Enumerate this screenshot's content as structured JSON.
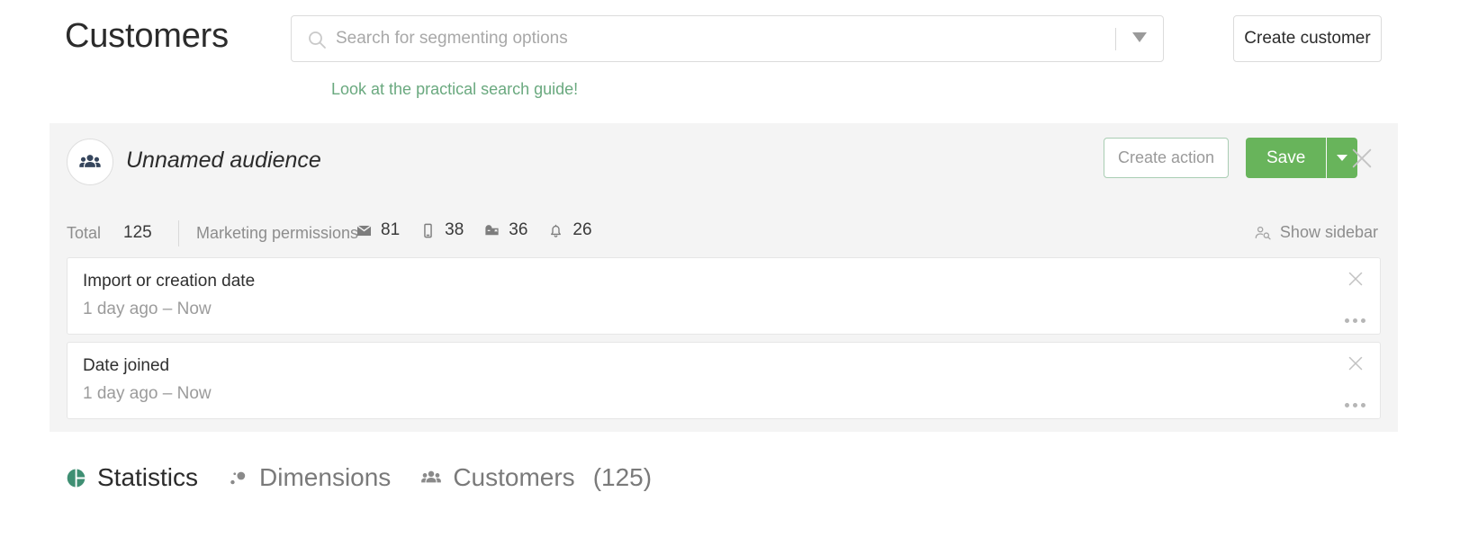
{
  "header": {
    "title": "Customers",
    "search": {
      "placeholder": "Search for segmenting options",
      "value": "",
      "icon": "search-icon",
      "caret_icon": "chevron-down-icon"
    },
    "create_customer_label": "Create customer",
    "search_guide_link": "Look at the practical search guide!"
  },
  "audience": {
    "avatar_icon": "people-group-icon",
    "name": "Unnamed audience",
    "create_action_label": "Create action",
    "save_label": "Save",
    "save_caret_icon": "chevron-down-icon",
    "close_icon": "close-icon",
    "stats": {
      "total_label": "Total",
      "total_value": "125",
      "permissions_label": "Marketing permissions",
      "permissions": [
        {
          "icon": "envelope-icon",
          "value": "81"
        },
        {
          "icon": "mobile-phone-icon",
          "value": "38"
        },
        {
          "icon": "mailbox-icon",
          "value": "36"
        },
        {
          "icon": "bell-icon",
          "value": "26"
        }
      ]
    },
    "show_sidebar_label": "Show sidebar",
    "show_sidebar_icon": "user-search-icon",
    "filters": [
      {
        "title": "Import or creation date",
        "range_from": "1 day ago",
        "range_dash": " – ",
        "range_to": "Now",
        "close_icon": "close-icon",
        "menu_icon": "ellipsis-icon"
      },
      {
        "title": "Date joined",
        "range_from": "1 day ago",
        "range_dash": " – ",
        "range_to": "Now",
        "close_icon": "close-icon",
        "menu_icon": "ellipsis-icon"
      }
    ]
  },
  "tabs": [
    {
      "label": "Statistics",
      "icon": "pie-chart-icon",
      "active": true,
      "count": ""
    },
    {
      "label": "Dimensions",
      "icon": "scatter-dots-icon",
      "active": false,
      "count": ""
    },
    {
      "label": "Customers",
      "icon": "people-group-icon",
      "active": false,
      "count": "(125)"
    }
  ],
  "colors": {
    "accent_green": "#68b45b",
    "link_green": "#6aa97f",
    "panel_bg": "#f4f4f4",
    "avatar_navy": "#36465d"
  }
}
